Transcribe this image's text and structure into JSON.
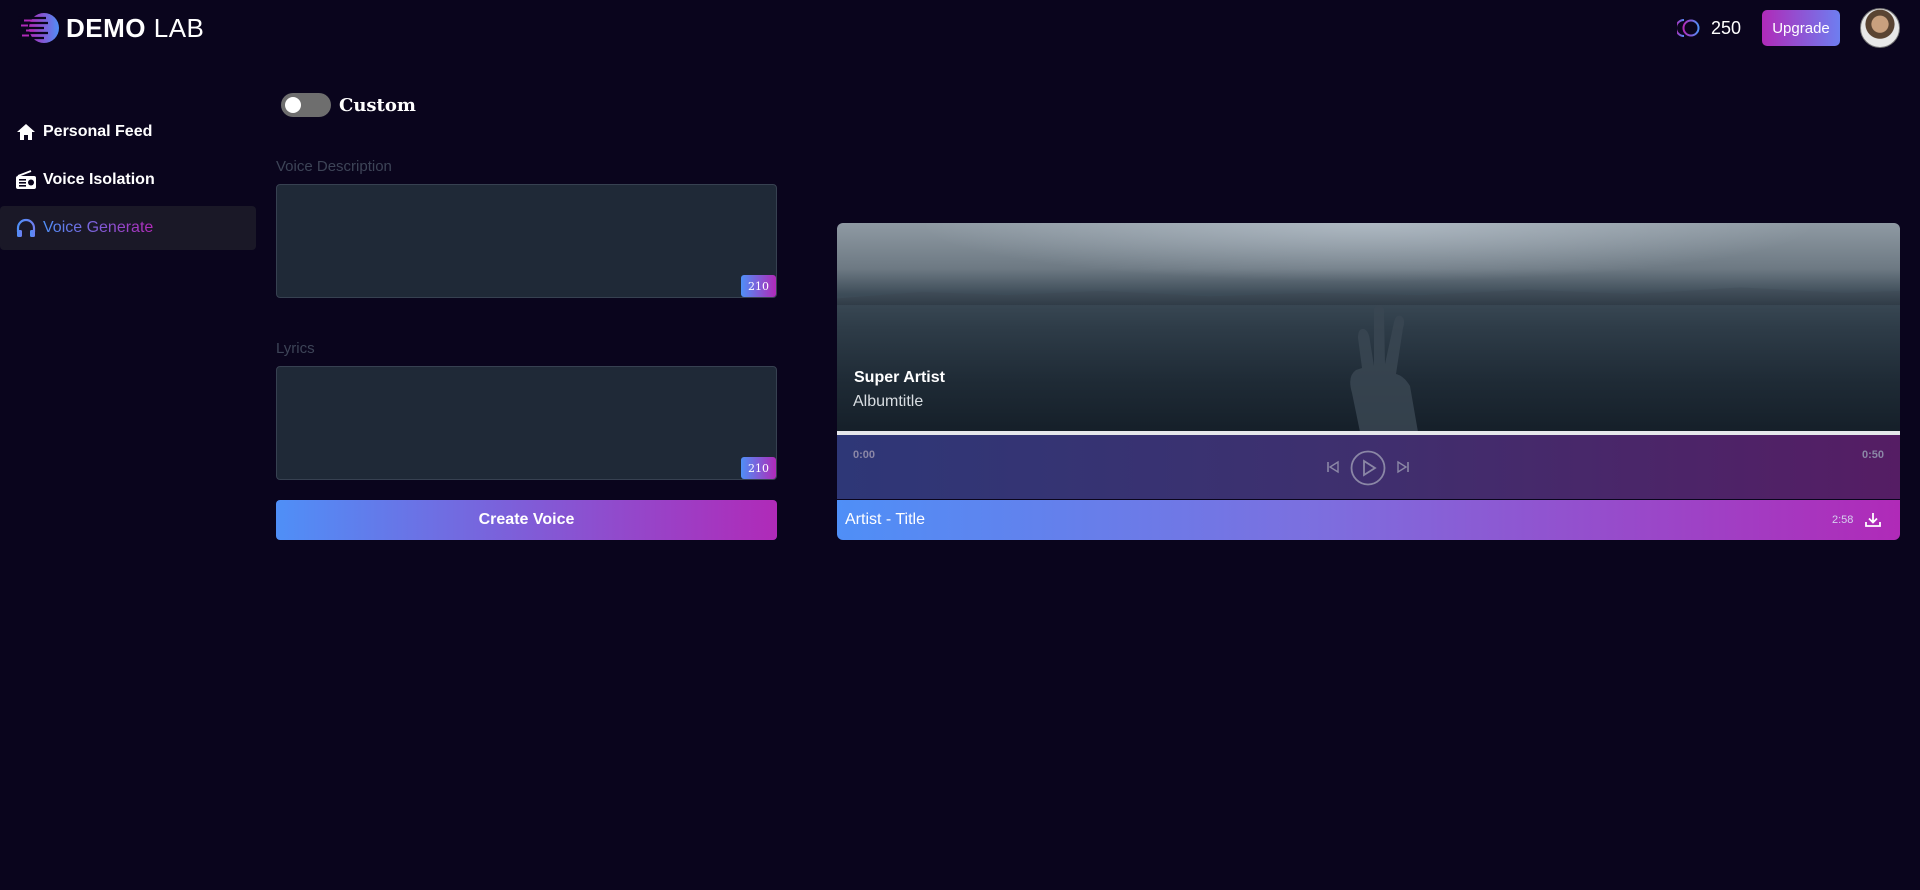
{
  "header": {
    "logo_bold": "DEMO",
    "logo_light": "LAB",
    "credits_icon": "credits-coin-icon",
    "credits": "250",
    "upgrade_label": "Upgrade",
    "avatar_icon": "user-avatar"
  },
  "sidebar": {
    "items": [
      {
        "label": "Personal Feed",
        "icon": "home-icon",
        "active": false
      },
      {
        "label": "Voice Isolation",
        "icon": "radio-icon",
        "active": false
      },
      {
        "label": "Voice Generate",
        "icon": "headphones-icon",
        "active": true
      }
    ]
  },
  "form": {
    "toggle_label": "Custom",
    "toggle_on": false,
    "voice_description_label": "Voice Description",
    "voice_description_value": "",
    "voice_description_count": "210",
    "lyrics_label": "Lyrics",
    "lyrics_value": "",
    "lyrics_count": "210",
    "create_label": "Create Voice"
  },
  "player": {
    "artist": "Super Artist",
    "album": "Albumtitle",
    "time_current": "0:00",
    "time_total": "0:50",
    "progress": 0,
    "track_title": "Artist - Title",
    "track_duration": "2:58",
    "icons": [
      "previous-icon",
      "play-icon",
      "next-icon",
      "download-icon"
    ]
  },
  "colors": {
    "background": "#0a051d",
    "accent_start": "#4f8ff7",
    "accent_end": "#b02ab8",
    "input_bg": "#1f2937"
  }
}
